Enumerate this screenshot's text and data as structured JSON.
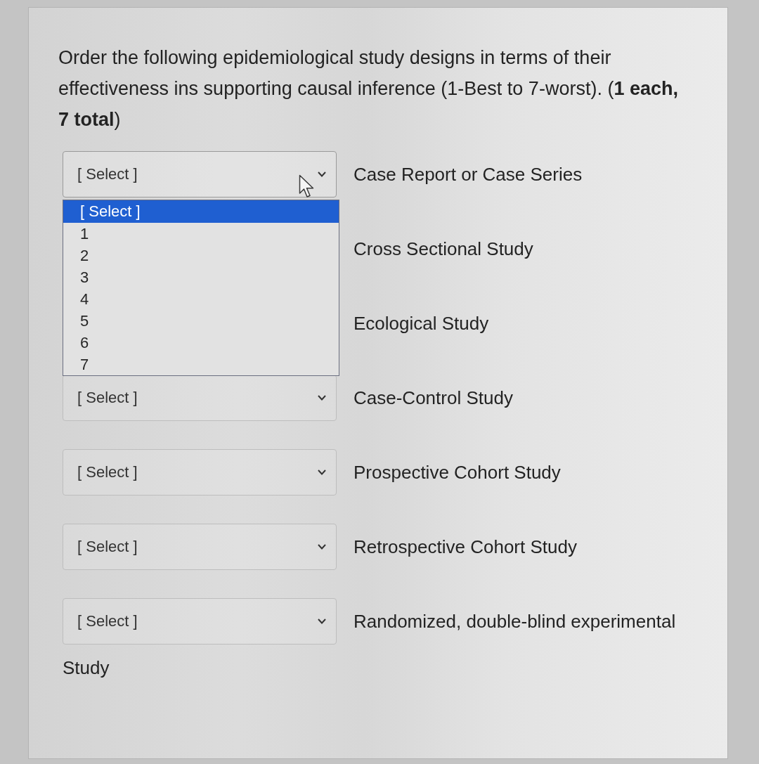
{
  "question": {
    "text": "Order the following epidemiological study designs in terms of their effectiveness ins supporting causal inference (1-Best to 7-worst). (**1 each, 7 total**)"
  },
  "items": [
    {
      "value": "[ Select ]",
      "expanded": true,
      "options": [
        {
          "label": "[ Select ]",
          "selected": true
        },
        {
          "label": "1",
          "selected": false
        },
        {
          "label": "2",
          "selected": false
        },
        {
          "label": "3",
          "selected": false
        },
        {
          "label": "4",
          "selected": false
        },
        {
          "label": "5",
          "selected": false
        },
        {
          "label": "6",
          "selected": false
        },
        {
          "label": "7",
          "selected": false
        }
      ],
      "label": "Case Report or Case Series"
    },
    {
      "label": "Cross Sectional Study"
    },
    {
      "label": "Ecological Study"
    },
    {
      "value": "[ Select ]",
      "expanded": false,
      "label": "Case-Control Study"
    },
    {
      "value": "[ Select ]",
      "expanded": false,
      "label": "Prospective Cohort Study"
    },
    {
      "value": "[ Select ]",
      "expanded": false,
      "label": "Retrospective Cohort Study"
    },
    {
      "value": "[ Select ]",
      "expanded": false,
      "label": "Randomized, double-blind experimental",
      "label_continued": "Study"
    }
  ]
}
